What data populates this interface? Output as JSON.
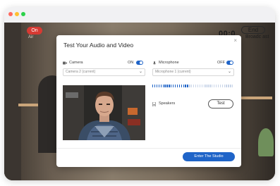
{
  "window": {
    "controls": [
      "close",
      "minimize",
      "maximize"
    ]
  },
  "stage": {
    "live_badge": "On",
    "live_sub": "Air",
    "timer": "00:0",
    "end_button": "End",
    "end_sub": "Broadc ast"
  },
  "modal": {
    "title": "Test Your Audio and Video",
    "close_icon": "×",
    "camera": {
      "label": "Camera",
      "state": "ON",
      "device": "Camera 2 (current)"
    },
    "microphone": {
      "label": "Microphone",
      "state": "OFF",
      "device": "Microphone 1 (current)",
      "level_fraction": 0.45
    },
    "speakers": {
      "label": "Speakers",
      "test_button": "Test"
    },
    "enter_button": "Enter The Studio"
  },
  "colors": {
    "accent": "#1f64c8",
    "live_red": "#d63a33"
  }
}
